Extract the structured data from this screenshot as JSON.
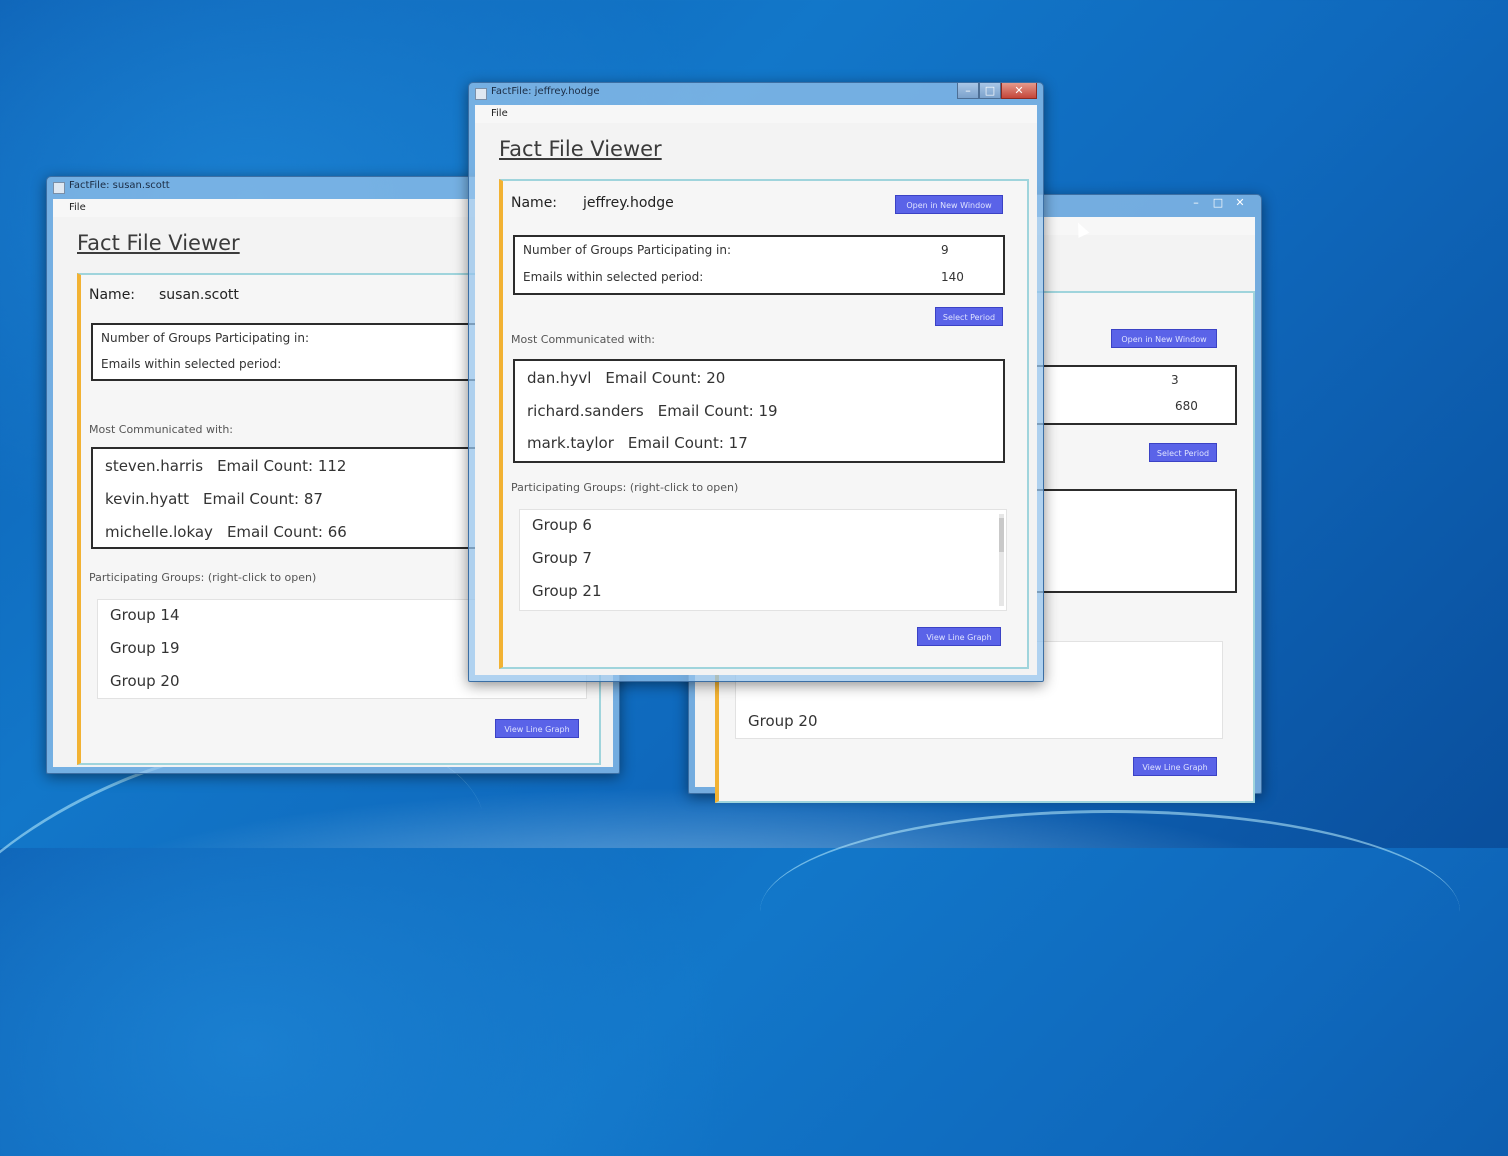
{
  "menu": {
    "file": "File"
  },
  "app_heading": "Fact File Viewer",
  "labels": {
    "name": "Name:",
    "groups": "Number of Groups Participating in:",
    "emails": "Emails within selected period:",
    "most": "Most Communicated with:",
    "participating": "Participating Groups: (right-click to open)",
    "email_count": "Email Count:"
  },
  "buttons": {
    "open_new_window": "Open in New Window",
    "select_period": "Select Period",
    "view_line_graph": "View Line Graph"
  },
  "win_left": {
    "title": "FactFile: susan.scott",
    "name": "susan.scott",
    "contacts": [
      {
        "name": "steven.harris",
        "count": "112"
      },
      {
        "name": "kevin.hyatt",
        "count": "87"
      },
      {
        "name": "michelle.lokay",
        "count": "66"
      }
    ],
    "groups": [
      "Group 14",
      "Group 19",
      "Group 20"
    ]
  },
  "win_front": {
    "title": "FactFile: jeffrey.hodge",
    "name": "jeffrey.hodge",
    "groups_count": "9",
    "emails_count": "140",
    "contacts": [
      {
        "name": "dan.hyvl",
        "count": "20"
      },
      {
        "name": "richard.sanders",
        "count": "19"
      },
      {
        "name": "mark.taylor",
        "count": "17"
      }
    ],
    "groups": [
      "Group 6",
      "Group 7",
      "Group 21"
    ]
  },
  "win_right": {
    "groups_count": "3",
    "emails_count": "680",
    "groups": [
      "Group 20"
    ]
  },
  "window_controls": {
    "minimize": "–",
    "maximize": "□",
    "close": "✕"
  }
}
